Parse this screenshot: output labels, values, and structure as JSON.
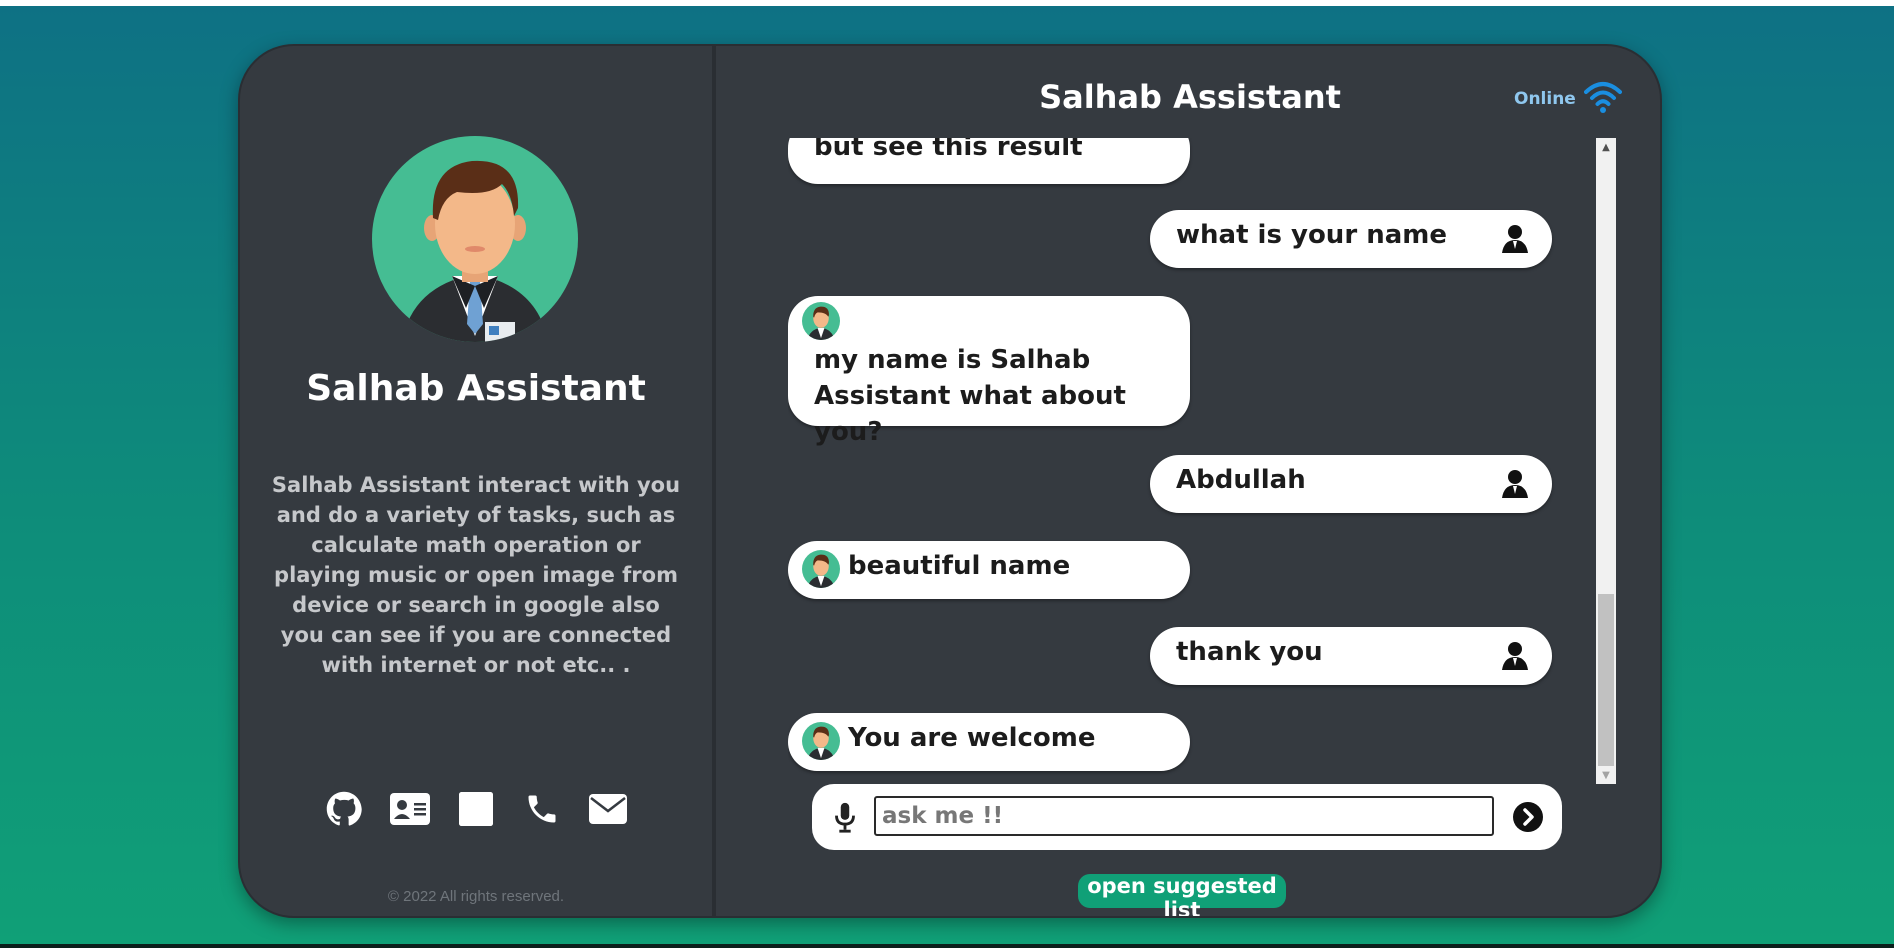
{
  "assistant": {
    "name": "Salhab Assistant",
    "description": "Salhab Assistant interact with you and do a variety of tasks, such as calculate math operation or playing music or open image from device or search in google also you can see if you are connected with internet or not etc.. ."
  },
  "social_icons": [
    "github-icon",
    "id-card-icon",
    "linkedin-icon",
    "phone-icon",
    "envelope-icon"
  ],
  "footer": {
    "copyright": "© 2022 All rights reserved."
  },
  "chat": {
    "title": "Salhab Assistant",
    "status": "Online",
    "messages": [
      {
        "sender": "bot",
        "text": "but see this result"
      },
      {
        "sender": "user",
        "text": "what is your name"
      },
      {
        "sender": "bot",
        "text": "my name is Salhab Assistant what about you?"
      },
      {
        "sender": "user",
        "text": "Abdullah"
      },
      {
        "sender": "bot",
        "text": "beautiful name"
      },
      {
        "sender": "user",
        "text": "thank you"
      },
      {
        "sender": "bot",
        "text": "You are welcome"
      }
    ],
    "input_placeholder": "ask me !!",
    "input_value": "",
    "suggest_label": "open suggested list"
  },
  "colors": {
    "card_bg": "#353a40",
    "accent_green": "#10a077",
    "avatar_bg": "#45bd93",
    "status_blue": "#8fc7ee",
    "wifi_blue": "#1a8ee0"
  }
}
